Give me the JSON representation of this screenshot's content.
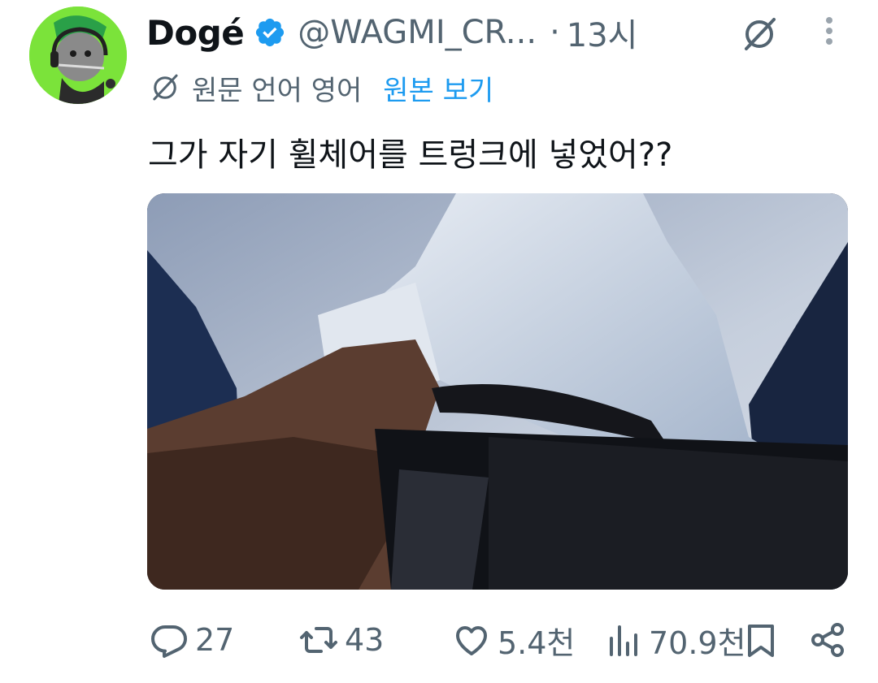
{
  "tweet": {
    "author_name": "Dogé",
    "handle": "@WAGMI_CR...",
    "separator": "·",
    "time": "13시",
    "translation": {
      "source_language": "원문 언어 영어",
      "view_original": "원본 보기"
    },
    "text": "그가 자기 휠체어를 트렁크에 넣었어??",
    "media": {
      "kind": "video-frame"
    },
    "stats": {
      "replies": "27",
      "retweets": "43",
      "likes": "5.4천",
      "views": "70.9천"
    }
  },
  "colors": {
    "text": "#0f1419",
    "secondary": "#536471",
    "accent": "#1d9bf0",
    "verified": "#1d9bf0",
    "avatar_bg": "#7be33a"
  },
  "icons": {
    "verified": "verified-badge-icon",
    "grok": "grok-icon",
    "more": "more-vertical-icon",
    "reply": "reply-icon",
    "retweet": "retweet-icon",
    "like": "heart-icon",
    "views": "views-icon",
    "bookmark": "bookmark-icon",
    "share": "share-icon"
  }
}
